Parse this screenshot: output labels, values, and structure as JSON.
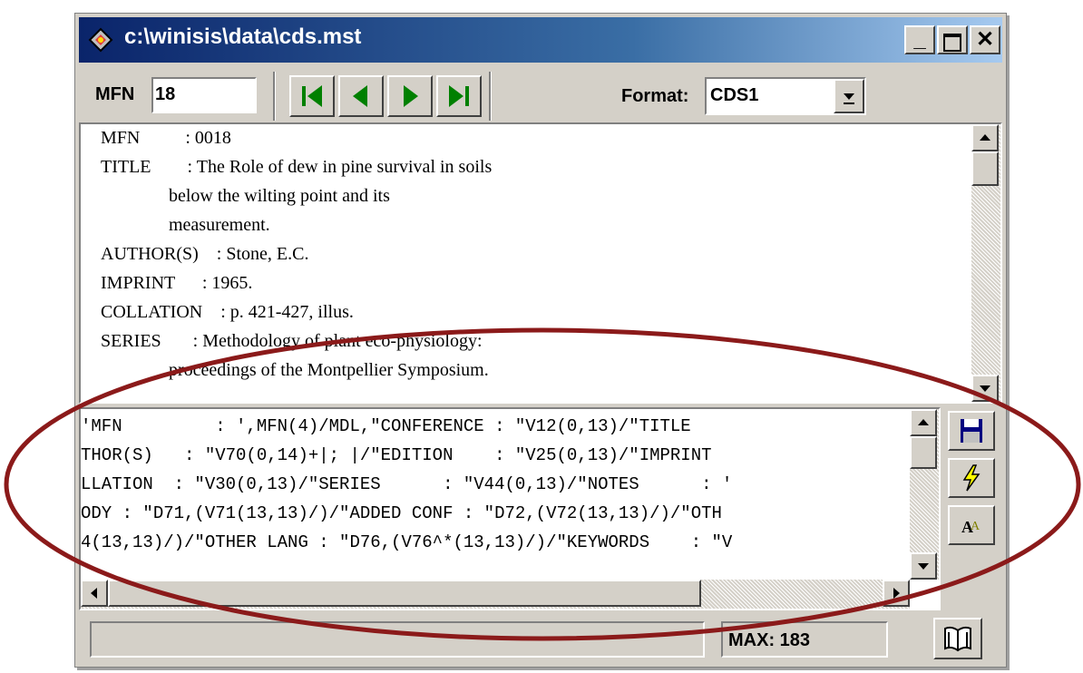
{
  "window": {
    "title": "c:\\winisis\\data\\cds.mst"
  },
  "toolbar": {
    "mfn_label": "MFN",
    "mfn_value": "18",
    "format_label": "Format:",
    "format_value": "CDS1"
  },
  "record": {
    "lines": [
      "MFN          : 0018",
      "TITLE        : The Role of dew in pine survival in soils",
      "               below the wilting point and its",
      "               measurement.",
      "AUTHOR(S)    : Stone, E.C.",
      "IMPRINT      : 1965.",
      "COLLATION    : p. 421-427, illus.",
      "SERIES       : Methodology of plant eco-physiology:",
      "               proceedings of the Montpellier Symposium."
    ]
  },
  "format_editor": {
    "lines": [
      "'MFN         : ',MFN(4)/MDL,\"CONFERENCE : \"V12(0,13)/\"TITLE",
      "THOR(S)   : \"V70(0,14)+|; |/\"EDITION    : \"V25(0,13)/\"IMPRINT",
      "LLATION  : \"V30(0,13)/\"SERIES      : \"V44(0,13)/\"NOTES      : '",
      "ODY : \"D71,(V71(13,13)/)/\"ADDED CONF : \"D72,(V72(13,13)/)/\"OTH",
      "4(13,13)/)/\"OTHER LANG : \"D76,(V76^*(13,13)/)/\"KEYWORDS    : \"V"
    ]
  },
  "status": {
    "max_label": "MAX: 183"
  },
  "icons": [
    "app-icon",
    "minimize-icon",
    "maximize-icon",
    "close-icon",
    "first-record-icon",
    "previous-record-icon",
    "next-record-icon",
    "last-record-icon",
    "dropdown-arrow-icon",
    "save-icon",
    "lightning-icon",
    "font-icon",
    "book-icon"
  ],
  "colors": {
    "titlebar": "#0a246a",
    "nav_arrow": "#008000",
    "annotation_ellipse": "#8b1a1a"
  }
}
